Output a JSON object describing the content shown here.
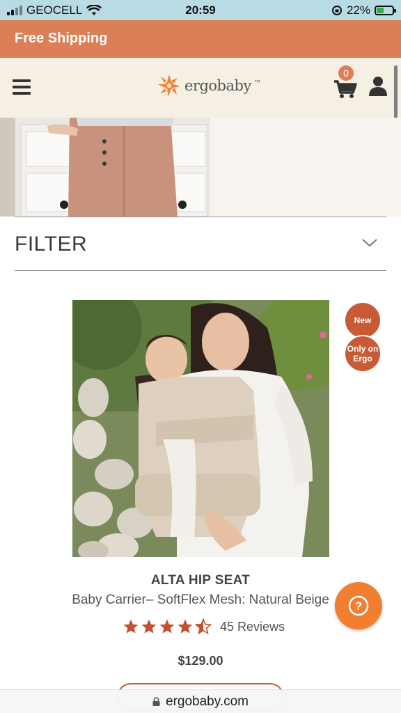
{
  "status_bar": {
    "carrier": "GEOCELL",
    "time": "20:59",
    "battery_percent": "22%"
  },
  "promo": {
    "text": "Free Shipping"
  },
  "header": {
    "logo_text": "ergobaby",
    "logo_tm": "™",
    "cart_count": "0",
    "accent_color": "#dc7f57"
  },
  "filter": {
    "label": "FILTER"
  },
  "product": {
    "badges": [
      "New",
      "Only on Ergo"
    ],
    "title": "ALTA HIP SEAT",
    "subtitle": "Baby Carrier– SoftFlex Mesh: Natural Beige",
    "rating": 4.5,
    "reviews": "45 Reviews",
    "price": "$129.00"
  },
  "help": {
    "icon": "?"
  },
  "browser": {
    "url": "ergobaby.com"
  }
}
